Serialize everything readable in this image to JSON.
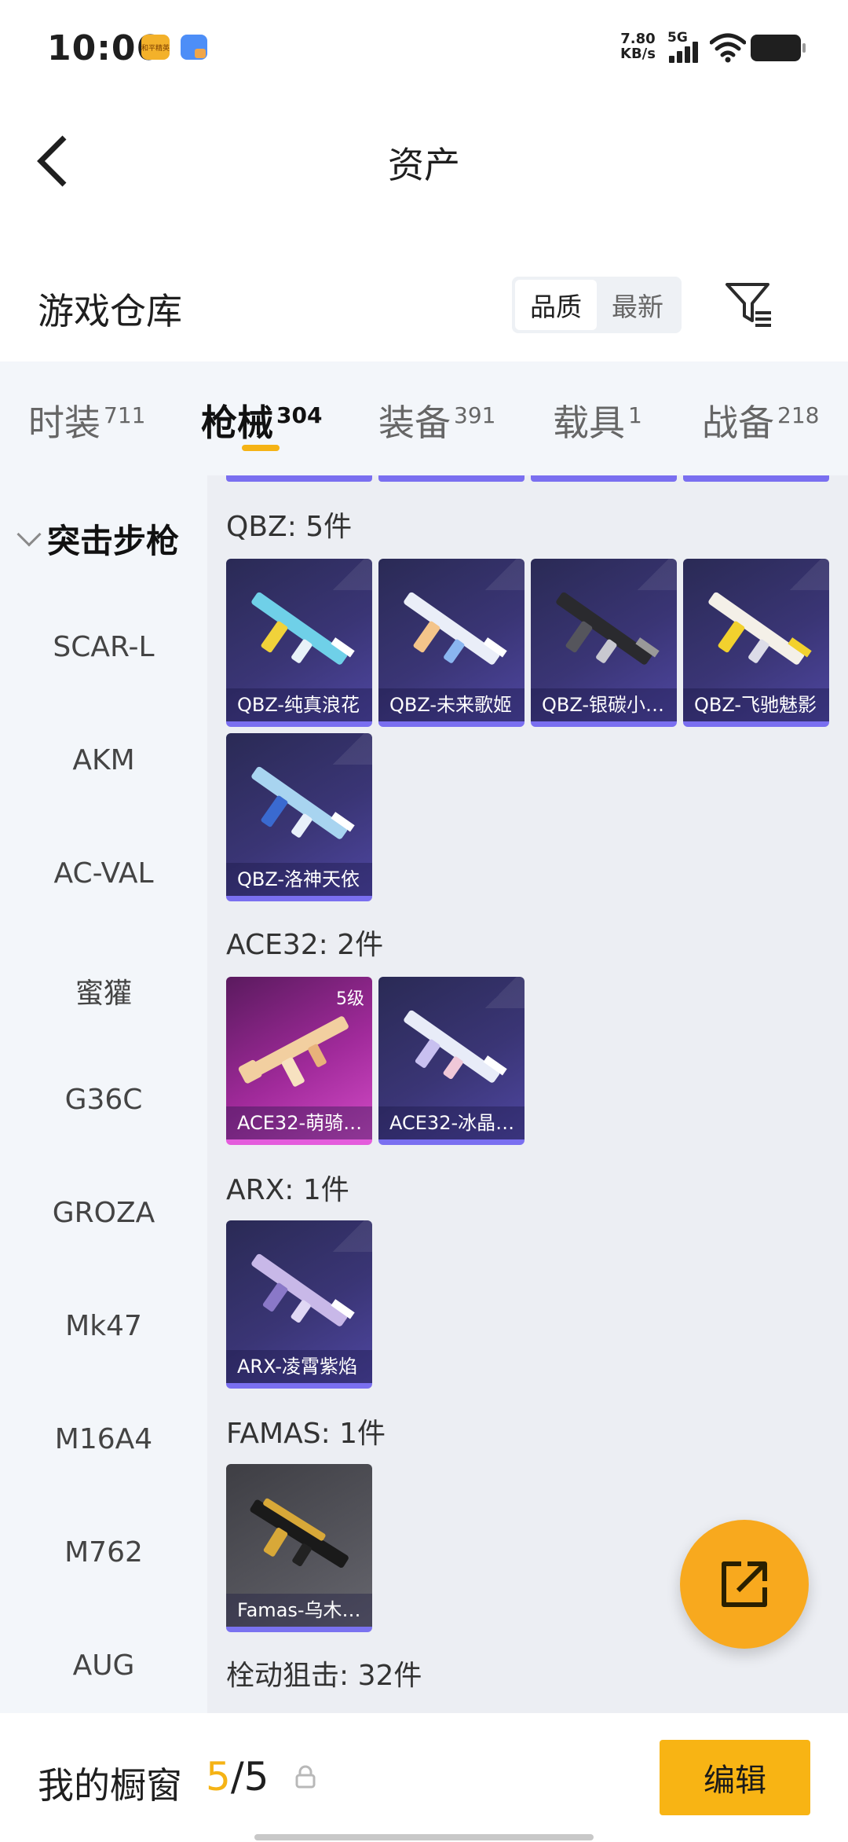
{
  "status_bar": {
    "time": "10:06",
    "app_badge_text": "和平精英",
    "net_speed_value": "7.80",
    "net_speed_unit": "KB/s",
    "network": "5G"
  },
  "header": {
    "title": "资产",
    "back_icon": "chevron-left-icon"
  },
  "warehouse": {
    "title": "游戏仓库",
    "sort_options": [
      "品质",
      "最新"
    ],
    "sort_selected": "品质",
    "filter_icon": "filter-icon"
  },
  "tabs": [
    {
      "label": "时装",
      "count": "711"
    },
    {
      "label": "枪械",
      "count": "304"
    },
    {
      "label": "装备",
      "count": "391"
    },
    {
      "label": "载具",
      "count": "1"
    },
    {
      "label": "战备",
      "count": "218"
    }
  ],
  "active_tab": "枪械",
  "sidebar": {
    "category": "突击步枪",
    "items": [
      "SCAR-L",
      "AKM",
      "AC-VAL",
      "蜜獾",
      "G36C",
      "GROZA",
      "Mk47",
      "M16A4",
      "M762",
      "AUG"
    ]
  },
  "groups": [
    {
      "title": "QBZ: 5件",
      "items": [
        {
          "name": "QBZ-纯真浪花"
        },
        {
          "name": "QBZ-未来歌姬"
        },
        {
          "name": "QBZ-银碳小…"
        },
        {
          "name": "QBZ-飞驰魅影"
        },
        {
          "name": "QBZ-洛神天依"
        }
      ]
    },
    {
      "title": "ACE32: 2件",
      "items": [
        {
          "name": "ACE32-萌骑…",
          "badge": "5级"
        },
        {
          "name": "ACE32-冰晶…"
        }
      ]
    },
    {
      "title": "ARX: 1件",
      "items": [
        {
          "name": "ARX-凌霄紫焰"
        }
      ]
    },
    {
      "title": "FAMAS: 1件",
      "items": [
        {
          "name": "Famas-乌木…"
        }
      ]
    },
    {
      "title": "栓动狙击: 32件",
      "items": []
    }
  ],
  "fab": {
    "icon": "share-export-icon"
  },
  "bottom_bar": {
    "label": "我的橱窗",
    "current": "5",
    "separator": "/",
    "total": "5",
    "lock_icon": "lock-icon",
    "edit_label": "编辑"
  },
  "colors": {
    "accent": "#f5b315",
    "card_purple": "#3a3575",
    "card_pink": "#a02a9a"
  }
}
